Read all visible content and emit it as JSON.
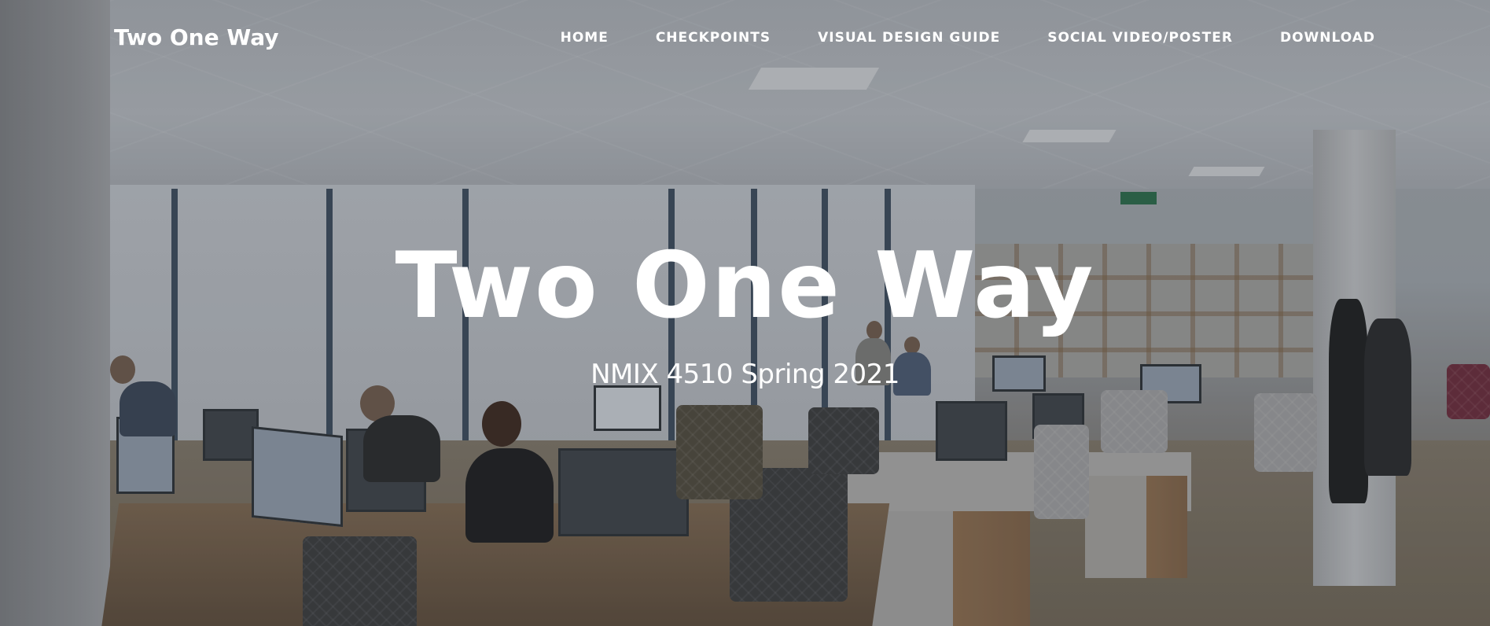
{
  "brand": {
    "name": "Two One Way"
  },
  "nav": {
    "items": [
      {
        "label": "HOME"
      },
      {
        "label": "CHECKPOINTS"
      },
      {
        "label": "VISUAL DESIGN GUIDE"
      },
      {
        "label": "SOCIAL VIDEO/POSTER"
      },
      {
        "label": "DOWNLOAD"
      }
    ]
  },
  "hero": {
    "title": "Two One Way",
    "subtitle": "NMIX 4510 Spring 2021",
    "background_image": "office-photo"
  },
  "colors": {
    "text": "#ffffff",
    "overlay": "#282a30"
  }
}
